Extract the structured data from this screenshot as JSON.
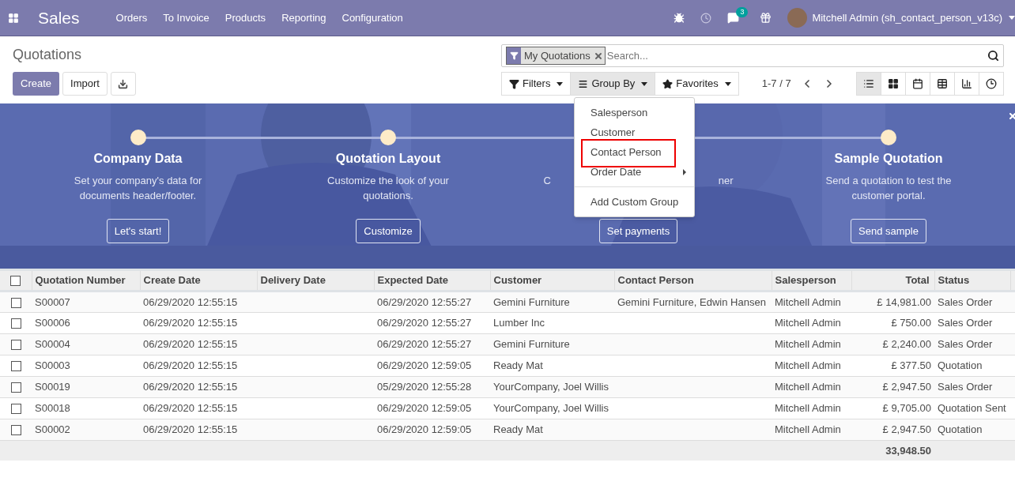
{
  "navbar": {
    "app_title": "Sales",
    "menu": [
      "Orders",
      "To Invoice",
      "Products",
      "Reporting",
      "Configuration"
    ],
    "message_count": "3",
    "user_name": "Mitchell Admin (sh_contact_person_v13c)"
  },
  "control_panel": {
    "title": "Quotations",
    "create_label": "Create",
    "import_label": "Import",
    "facet": "My Quotations",
    "search_placeholder": "Search...",
    "search_buttons": [
      {
        "kind": "filter",
        "label": "Filters",
        "open": false
      },
      {
        "kind": "group",
        "label": "Group By",
        "open": true
      },
      {
        "kind": "star",
        "label": "Favorites",
        "open": false
      }
    ],
    "pager": "1-7 / 7",
    "views": [
      {
        "kind": "list",
        "selected": true
      },
      {
        "kind": "kanban",
        "selected": false
      },
      {
        "kind": "calendar",
        "selected": false
      },
      {
        "kind": "pivot",
        "selected": false
      },
      {
        "kind": "graph",
        "selected": false
      },
      {
        "kind": "activity",
        "selected": false
      }
    ]
  },
  "group_by_menu": {
    "items": [
      {
        "label": "Salesperson",
        "highlighted": false,
        "submenu": false
      },
      {
        "label": "Customer",
        "highlighted": false,
        "submenu": false
      },
      {
        "label": "Contact Person",
        "highlighted": true,
        "submenu": false
      },
      {
        "label": "Order Date",
        "highlighted": false,
        "submenu": true
      }
    ],
    "custom": "Add Custom Group"
  },
  "banner": {
    "steps": [
      {
        "title": "Company Data",
        "description": "Set your company's data for documents header/footer.",
        "button": "Let's start!"
      },
      {
        "title": "Quotation Layout",
        "description": "Customize the look of your quotations.",
        "button": "Customize"
      },
      {
        "description_parts": [
          "C",
          "ner"
        ],
        "button": "Set payments"
      },
      {
        "title": "Sample Quotation",
        "description": "Send a quotation to test the customer portal.",
        "button": "Send sample"
      }
    ]
  },
  "table": {
    "all_selected": false,
    "columns": [
      {
        "label": "Quotation Number"
      },
      {
        "label": "Create Date"
      },
      {
        "label": "Delivery Date"
      },
      {
        "label": "Expected Date"
      },
      {
        "label": "Customer"
      },
      {
        "label": "Contact Person"
      },
      {
        "label": "Salesperson"
      },
      {
        "label": "Total"
      },
      {
        "label": "Status"
      }
    ],
    "rows": [
      {
        "selected": false,
        "cells": [
          "S00007",
          "06/29/2020 12:55:15",
          "",
          "06/29/2020 12:55:27",
          "Gemini Furniture",
          "Gemini Furniture, Edwin Hansen",
          "Mitchell Admin",
          "£ 14,981.00",
          "Sales Order"
        ]
      },
      {
        "selected": false,
        "cells": [
          "S00006",
          "06/29/2020 12:55:15",
          "",
          "06/29/2020 12:55:27",
          "Lumber Inc",
          "",
          "Mitchell Admin",
          "£ 750.00",
          "Sales Order"
        ]
      },
      {
        "selected": false,
        "cells": [
          "S00004",
          "06/29/2020 12:55:15",
          "",
          "06/29/2020 12:55:27",
          "Gemini Furniture",
          "",
          "Mitchell Admin",
          "£ 2,240.00",
          "Sales Order"
        ]
      },
      {
        "selected": false,
        "cells": [
          "S00003",
          "06/29/2020 12:55:15",
          "",
          "06/29/2020 12:59:05",
          "Ready Mat",
          "",
          "Mitchell Admin",
          "£ 377.50",
          "Quotation"
        ]
      },
      {
        "selected": false,
        "cells": [
          "S00019",
          "06/29/2020 12:55:15",
          "",
          "05/29/2020 12:55:28",
          "YourCompany, Joel Willis",
          "",
          "Mitchell Admin",
          "£ 2,947.50",
          "Sales Order"
        ]
      },
      {
        "selected": false,
        "cells": [
          "S00018",
          "06/29/2020 12:55:15",
          "",
          "06/29/2020 12:59:05",
          "YourCompany, Joel Willis",
          "",
          "Mitchell Admin",
          "£ 9,705.00",
          "Quotation Sent"
        ]
      },
      {
        "selected": false,
        "cells": [
          "S00002",
          "06/29/2020 12:55:15",
          "",
          "06/29/2020 12:59:05",
          "Ready Mat",
          "",
          "Mitchell Admin",
          "£ 2,947.50",
          "Quotation"
        ]
      }
    ],
    "total": "33,948.50"
  }
}
